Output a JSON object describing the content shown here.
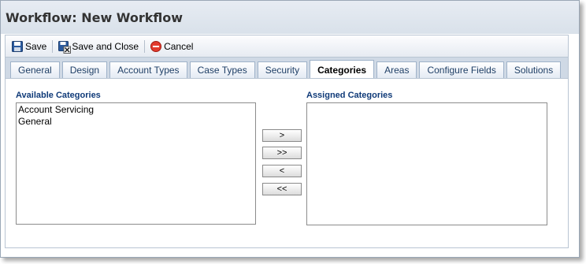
{
  "window": {
    "title": "Workflow: New Workflow"
  },
  "toolbar": {
    "save_label": "Save",
    "save_close_label": "Save and Close",
    "cancel_label": "Cancel"
  },
  "tabs": [
    {
      "label": "General",
      "active": false
    },
    {
      "label": "Design",
      "active": false
    },
    {
      "label": "Account Types",
      "active": false
    },
    {
      "label": "Case Types",
      "active": false
    },
    {
      "label": "Security",
      "active": false
    },
    {
      "label": "Categories",
      "active": true
    },
    {
      "label": "Areas",
      "active": false
    },
    {
      "label": "Configure Fields",
      "active": false
    },
    {
      "label": "Solutions",
      "active": false
    }
  ],
  "available": {
    "label": "Available Categories",
    "items": [
      "Account Servicing",
      "General"
    ]
  },
  "assigned": {
    "label": "Assigned Categories",
    "items": []
  },
  "move_buttons": {
    "add": ">",
    "add_all": ">>",
    "remove": "<",
    "remove_all": "<<"
  },
  "colors": {
    "tab_text": "#1f3f66",
    "label_text": "#0f3a78",
    "title_bar": "#dde4ec"
  }
}
